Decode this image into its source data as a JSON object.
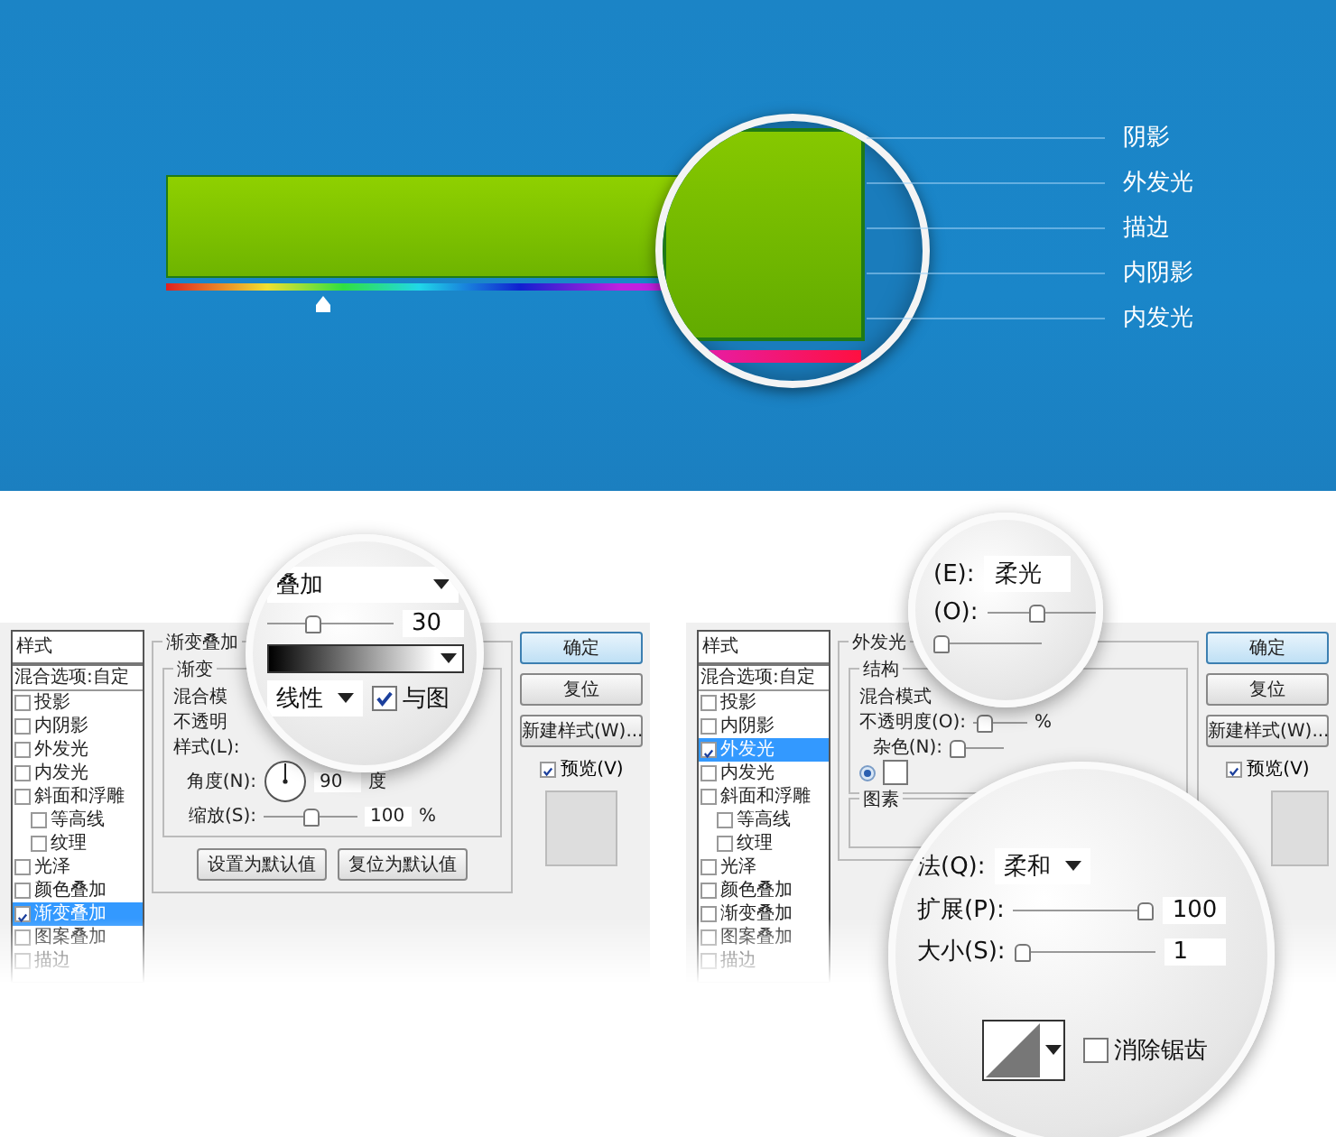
{
  "banner": {
    "callout_labels": [
      "阴影",
      "外发光",
      "描边",
      "内阴影",
      "内发光"
    ]
  },
  "dialogs": [
    {
      "styles": {
        "header": "样式",
        "blend_options": "混合选项:自定",
        "items": [
          {
            "label": "投影",
            "checked": false,
            "selected": false
          },
          {
            "label": "内阴影",
            "checked": false,
            "selected": false
          },
          {
            "label": "外发光",
            "checked": false,
            "selected": false
          },
          {
            "label": "内发光",
            "checked": false,
            "selected": false
          },
          {
            "label": "斜面和浮雕",
            "checked": false,
            "selected": false,
            "children": [
              {
                "label": "等高线",
                "checked": false,
                "selected": false
              },
              {
                "label": "纹理",
                "checked": false,
                "selected": false
              }
            ]
          },
          {
            "label": "光泽",
            "checked": false,
            "selected": false
          },
          {
            "label": "颜色叠加",
            "checked": false,
            "selected": false
          },
          {
            "label": "渐变叠加",
            "checked": true,
            "selected": true
          },
          {
            "label": "图案叠加",
            "checked": false,
            "selected": false
          },
          {
            "label": "描边",
            "checked": false,
            "selected": false
          }
        ]
      },
      "group_title": "渐变叠加",
      "subgroups": [
        {
          "title": "渐变",
          "rows": [
            {
              "kind": "text",
              "label": "混合模"
            },
            {
              "kind": "text",
              "label": "不透明"
            },
            {
              "kind": "text",
              "label": "样式(L):"
            },
            {
              "kind": "angle",
              "label": "角度(N):",
              "value": "90",
              "unit": "度"
            },
            {
              "kind": "slider",
              "label": "缩放(S):",
              "level": 0.5,
              "value": "100",
              "unit": "%"
            }
          ]
        }
      ],
      "footer_buttons": [
        "设置为默认值",
        "复位为默认值"
      ],
      "buttons": [
        {
          "label": "确定",
          "default": true
        },
        {
          "label": "复位",
          "default": false
        },
        {
          "label": "新建样式(W)...",
          "default": false
        }
      ],
      "preview": {
        "label": "预览(V)",
        "checked": true
      }
    },
    {
      "styles": {
        "header": "样式",
        "blend_options": "混合选项:自定",
        "items": [
          {
            "label": "投影",
            "checked": false,
            "selected": false
          },
          {
            "label": "内阴影",
            "checked": false,
            "selected": false
          },
          {
            "label": "外发光",
            "checked": true,
            "selected": true
          },
          {
            "label": "内发光",
            "checked": false,
            "selected": false
          },
          {
            "label": "斜面和浮雕",
            "checked": false,
            "selected": false,
            "children": [
              {
                "label": "等高线",
                "checked": false,
                "selected": false
              },
              {
                "label": "纹理",
                "checked": false,
                "selected": false
              }
            ]
          },
          {
            "label": "光泽",
            "checked": false,
            "selected": false
          },
          {
            "label": "颜色叠加",
            "checked": false,
            "selected": false
          },
          {
            "label": "渐变叠加",
            "checked": false,
            "selected": false
          },
          {
            "label": "图案叠加",
            "checked": false,
            "selected": false
          },
          {
            "label": "描边",
            "checked": false,
            "selected": false
          }
        ]
      },
      "group_title": "外发光",
      "subgroups": [
        {
          "title": "结构",
          "rows": [
            {
              "kind": "text",
              "label": "混合模式"
            },
            {
              "kind": "slider",
              "label": "不透明度(O):",
              "level": 0.1,
              "unit": "%"
            },
            {
              "kind": "slider",
              "label": "杂色(N):",
              "level": 0
            },
            {
              "kind": "color"
            }
          ]
        },
        {
          "title": "图素"
        }
      ],
      "buttons": [
        {
          "label": "确定",
          "default": true
        },
        {
          "label": "复位",
          "default": false
        },
        {
          "label": "新建样式(W)...",
          "default": false
        }
      ],
      "preview": {
        "label": "预览(V)",
        "checked": true
      }
    }
  ],
  "magnifiers": [
    {
      "rows": [
        {
          "kind": "dropdown",
          "value": "叠加"
        },
        {
          "kind": "slider",
          "level": 0.35,
          "value": "30"
        },
        {
          "kind": "gradient"
        },
        {
          "kind": "dropdown",
          "value": "线性",
          "check_label": "与图",
          "checked": true
        }
      ]
    },
    {
      "rows": [
        {
          "kind": "field",
          "label": "(E):",
          "value": "柔光"
        },
        {
          "kind": "slider",
          "label": "(O):",
          "level": 0.45
        },
        {
          "kind": "slider",
          "level": 0
        }
      ]
    },
    {
      "rows": [
        {
          "kind": "dropdown",
          "label": "法(Q):",
          "value": "柔和"
        },
        {
          "kind": "slider",
          "label": "扩展(P):",
          "level": 1,
          "value": "100"
        },
        {
          "kind": "slider",
          "label": "大小(S):",
          "level": 0,
          "value": "1"
        },
        {
          "kind": "contour",
          "check_label": "消除锯齿",
          "checked": false
        }
      ]
    }
  ]
}
